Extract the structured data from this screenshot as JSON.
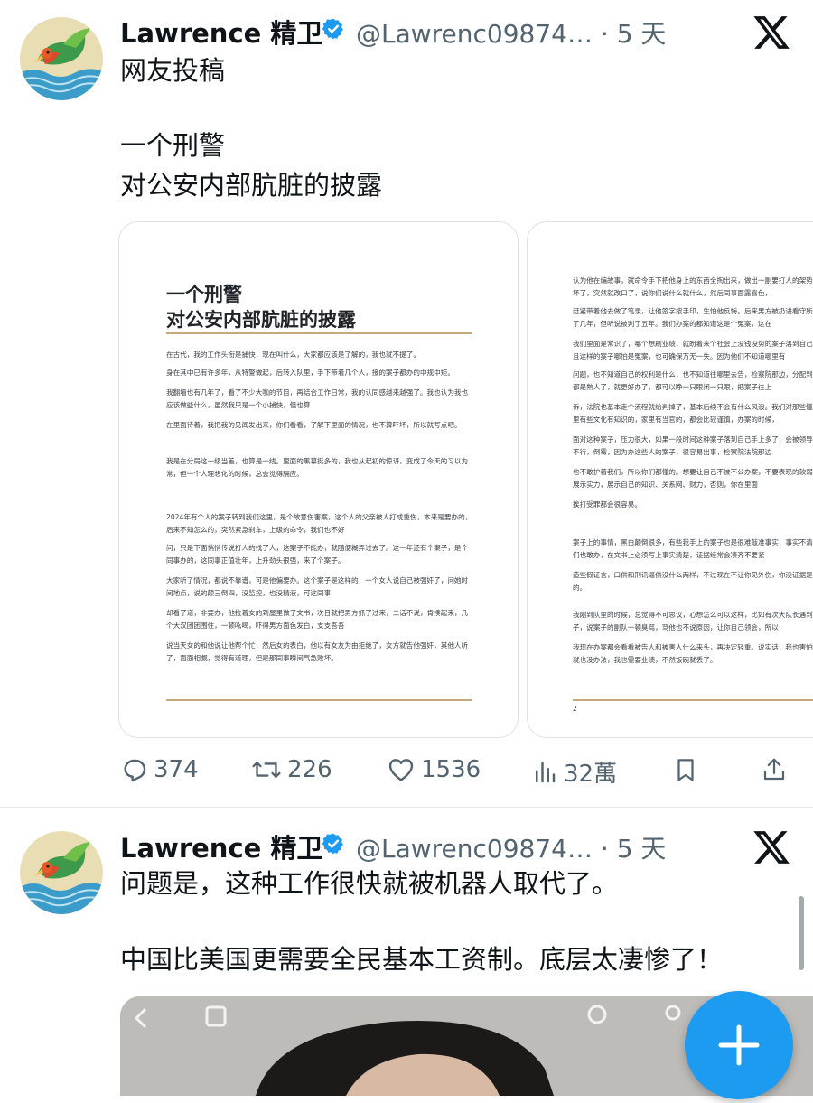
{
  "post1": {
    "author_name": "Lawrence 精卫",
    "handle": "@Lawrenc09874…",
    "separator": "·",
    "time": "5 天",
    "text_lines": [
      "网友投稿",
      "",
      "一个刑警",
      "对公安内部肮脏的披露"
    ],
    "images": [
      {
        "title_lines": [
          "一个刑警",
          "对公安内部肮脏的披露"
        ],
        "paragraphs": [
          "在古代，我的工作头衔是捕快，现在叫什么，大家都应该是了解的，我也就不提了。",
          "身在其中已有许多年，从特警做起，后转入队里，手下带着几个人，接的案子都办的中规中矩。",
          "我翻墙也有几年了，看了不少大咖的节目，再结合工作日常，我的认同感越来越强了。我也认为我也应该做些什么，虽然我只是一个小捕快，但也算",
          "在里面待着，我把我的见闻发出来，你们看看，了解下里面的情况，也不算吓坏，所以就写点吧。",
          "我是在分局这一级当差，也算是一线。里面的黑幕挺多的，我也从起初的惊讶，变成了今天的习以为常，但一个人理想化的时候，总会觉得膈应。",
          "2024年有个人的案子转到我们这里，是个故意伤害案，这个人的父亲被人打成重伤，本来是要办的，后来不知怎么的，突然紧急刹车，上级的命令，我们也不好",
          "问，只是下面悄悄传说打人的找了人，这案子不能办，就随便糊弄过去了。这一年还有个案子，是个同事办的，这同事正值壮年，上升劲头很强，来了个案子。",
          "大家听了情况，都说不靠谱，可是他偏要办。这个案子是这样的，一个女人说自己被强奸了，问她时间地点，说的颠三倒四，没监控，也没精液，可这同事",
          "却看了道，非要办，他拉着女的到屋里做了文书，次日就把男方抓了过来，二话不说，肯揍起来，几个大汉团团围住，一顿吆喝，吓得男方面色发白，支支吾吾",
          "说当天女的和他说让他帮个忙，然后女的表白，他以有女友为由拒绝了，女方就告他强奸，其他人听了，面面相觑，觉得有道理，但是那同事瞬间气急败坏。"
        ]
      },
      {
        "page_number": "2",
        "paragraphs": [
          "认为他在编故事，就命令手下把他身上的东西全掏出来，做出一副要打人的架势，男方吓坏了，突然就改口了，说你们说什么就什么，然后同事面露喜色，",
          "赶紧带着他去做了笔录，让他签字按手印，生怕他反悔。后来男方被扔进看守所，最后判了几年，但听说被判了五年。我们办案的都知道这是个冤案，这在",
          "我们里面是常识了，哪个想刷业绩，就盼着来个社会上没钱没势的案子落到自己手上，而且这样的案子哪怕是冤案，也可确保万无一失。因为他们不知道哪里有",
          "问题，也不知道自己的权利是什么，也不知道往哪里去告，检察院那边，分配到的又基本都是熟人了，就更好办了，都可以睁一只眼闭一只眼，把案子往上",
          "诉，法院也基本走个流程就给判掉了，基本后续不会有什么风浪。我们对那些懂法的、家里有些文化有知识的，家里有当官的，都会比较谨慎，办案的时候，",
          "面对这种案子，压力很大，如果一段时间这种案子落到自己手上多了，会被领导认为能力不行，倒霉，因为办这些人的案子，很容易出事，检察院法院那边",
          "也不敢护着我们，所以你们都懂的。想要让自己不被不公办案，不要表现的软弱，要适当展示实力，展示自己的知识、关系网、财力，否则，你在里面",
          "挨打受罪都会很容易。",
          "案子上的事情，黑白颠倒很多，有些我手上的案子也是很难敲准事实，事实不清，但是我们也敢办，在文书上必须写上事实清楚，证据经常会凑齐不要紧",
          "造些假证言，口供和刑讯逼供没什么两样，不过现在不让你见外伤，你没证据是很难告的。",
          "我刚到队里的时候，总觉得不可思议，心想怎么可以这样，比如有次大队长遇到一个案子，说案子的副队一顿臭骂，骂他也不说原因，让你自己领会，所以",
          "我现在办案都会看看被告人和被害人什么来头，再决定轻重。说实话，我也害怕，怕哪天就也没办法，我也需要业绩，不然饭碗就丢了。"
        ]
      }
    ],
    "stats": {
      "replies": "374",
      "reposts": "226",
      "likes": "1536",
      "views": "32萬"
    }
  },
  "post2": {
    "author_name": "Lawrence 精卫",
    "handle": "@Lawrenc09874…",
    "separator": "·",
    "time": "5 天",
    "text_lines": [
      "问题是，这种工作很快就被机器人取代了。",
      "",
      "中国比美国更需要全民基本工资制。底层太凄惨了！"
    ]
  },
  "colors": {
    "accent": "#1d9bf0",
    "verified": "#1d9bf0",
    "secondary_text": "#536471",
    "doc_rule": "#c9a87c"
  },
  "icons": [
    "avatar-bird-icon",
    "verified-badge-icon",
    "x-logo-icon",
    "reply-icon",
    "repost-icon",
    "like-icon",
    "views-icon",
    "bookmark-icon",
    "share-icon",
    "compose-plus-icon"
  ]
}
